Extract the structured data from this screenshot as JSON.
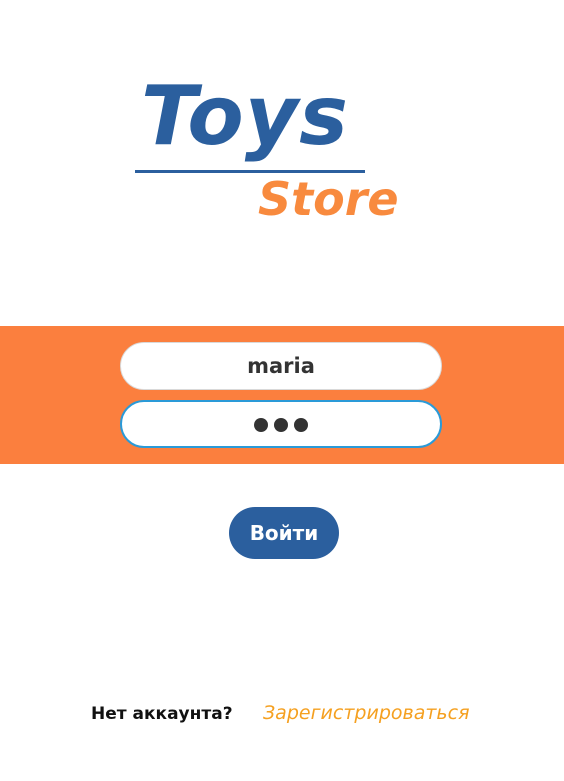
{
  "logo": {
    "primary_text": "Toys",
    "secondary_text": "Store",
    "primary_color": "#2b5f9e",
    "secondary_color": "#f88a3e"
  },
  "form": {
    "login_value": "maria",
    "password_masked": "•••",
    "password_length": 3,
    "band_color": "#fb7f3e"
  },
  "login_button": {
    "label": "Войти",
    "color": "#2b5f9e"
  },
  "footer": {
    "prompt": "Нет аккаунта?",
    "register_label": "Зарегистрироваться",
    "register_color": "#f5a020"
  }
}
